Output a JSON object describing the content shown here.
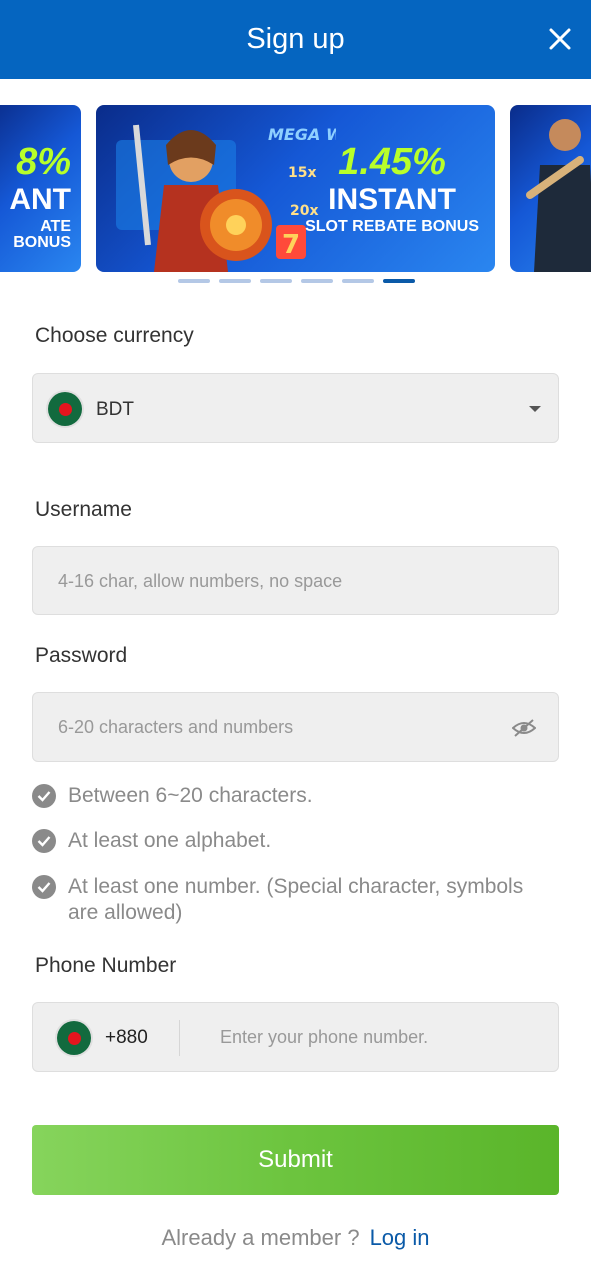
{
  "header": {
    "title": "Sign up"
  },
  "banner": {
    "main": {
      "percent": "1.45%",
      "headline": "INSTANT",
      "subtitle": "SLOT REBATE BONUS",
      "badge": "MEGA WIN"
    },
    "left": {
      "percent": "8%",
      "headline": "ANT",
      "subtitle": "ATE BONUS"
    },
    "dots_total": 6,
    "active_dot": 6
  },
  "currency": {
    "label": "Choose currency",
    "value": "BDT"
  },
  "username": {
    "label": "Username",
    "placeholder": "4-16 char, allow numbers, no space"
  },
  "password": {
    "label": "Password",
    "placeholder": "6-20 characters and numbers",
    "rules": [
      "Between 6~20 characters.",
      "At least one alphabet.",
      "At least one number. (Special character, symbols are allowed)"
    ]
  },
  "phone": {
    "label": "Phone Number",
    "code": "+880",
    "placeholder": "Enter your phone number."
  },
  "submit_label": "Submit",
  "footer": {
    "text": "Already a member ?",
    "link": "Log in"
  },
  "colors": {
    "header": "#0565c0",
    "submit": "#6cc43e",
    "link": "#0a5aa8"
  }
}
